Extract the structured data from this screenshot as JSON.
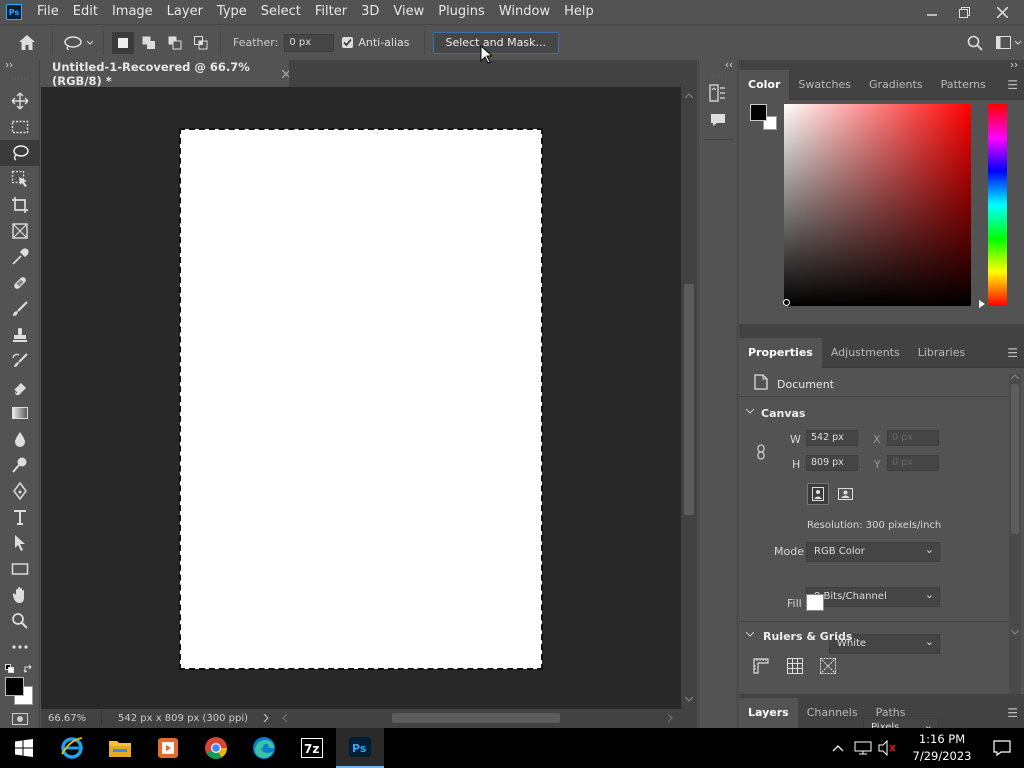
{
  "menubar": {
    "logo": "Ps",
    "items": [
      "File",
      "Edit",
      "Image",
      "Layer",
      "Type",
      "Select",
      "Filter",
      "3D",
      "View",
      "Plugins",
      "Window",
      "Help"
    ]
  },
  "options": {
    "feather_label": "Feather:",
    "feather_value": "0 px",
    "antialias_label": "Anti-alias",
    "antialias_checked": true,
    "select_mask_label": "Select and Mask..."
  },
  "document": {
    "tab_title": "Untitled-1-Recovered @ 66.7% (RGB/8) *",
    "zoom": "66.67%",
    "info": "542 px x 809 px (300 ppi)"
  },
  "color_panel": {
    "tabs": [
      "Color",
      "Swatches",
      "Gradients",
      "Patterns"
    ],
    "active_tab": "Color",
    "foreground": "#000000",
    "background": "#ffffff",
    "hue_color": "#ff0000"
  },
  "properties_panel": {
    "tabs": [
      "Properties",
      "Adjustments",
      "Libraries"
    ],
    "active_tab": "Properties",
    "document_label": "Document",
    "canvas_section": "Canvas",
    "w_label": "W",
    "w_value": "542 px",
    "h_label": "H",
    "h_value": "809 px",
    "x_label": "X",
    "x_placeholder": "0 px",
    "y_label": "Y",
    "y_placeholder": "0 px",
    "resolution": "Resolution: 300 pixels/inch",
    "mode_label": "Mode",
    "mode_value": "RGB Color",
    "bits_value": "8 Bits/Channel",
    "fill_label": "Fill",
    "fill_value": "White",
    "rulers_section": "Rulers & Grids",
    "units_value": "Pixels"
  },
  "layers_panel": {
    "tabs": [
      "Layers",
      "Channels",
      "Paths"
    ],
    "active_tab": "Layers"
  },
  "taskbar": {
    "time": "1:16 PM",
    "date": "7/29/2023"
  }
}
